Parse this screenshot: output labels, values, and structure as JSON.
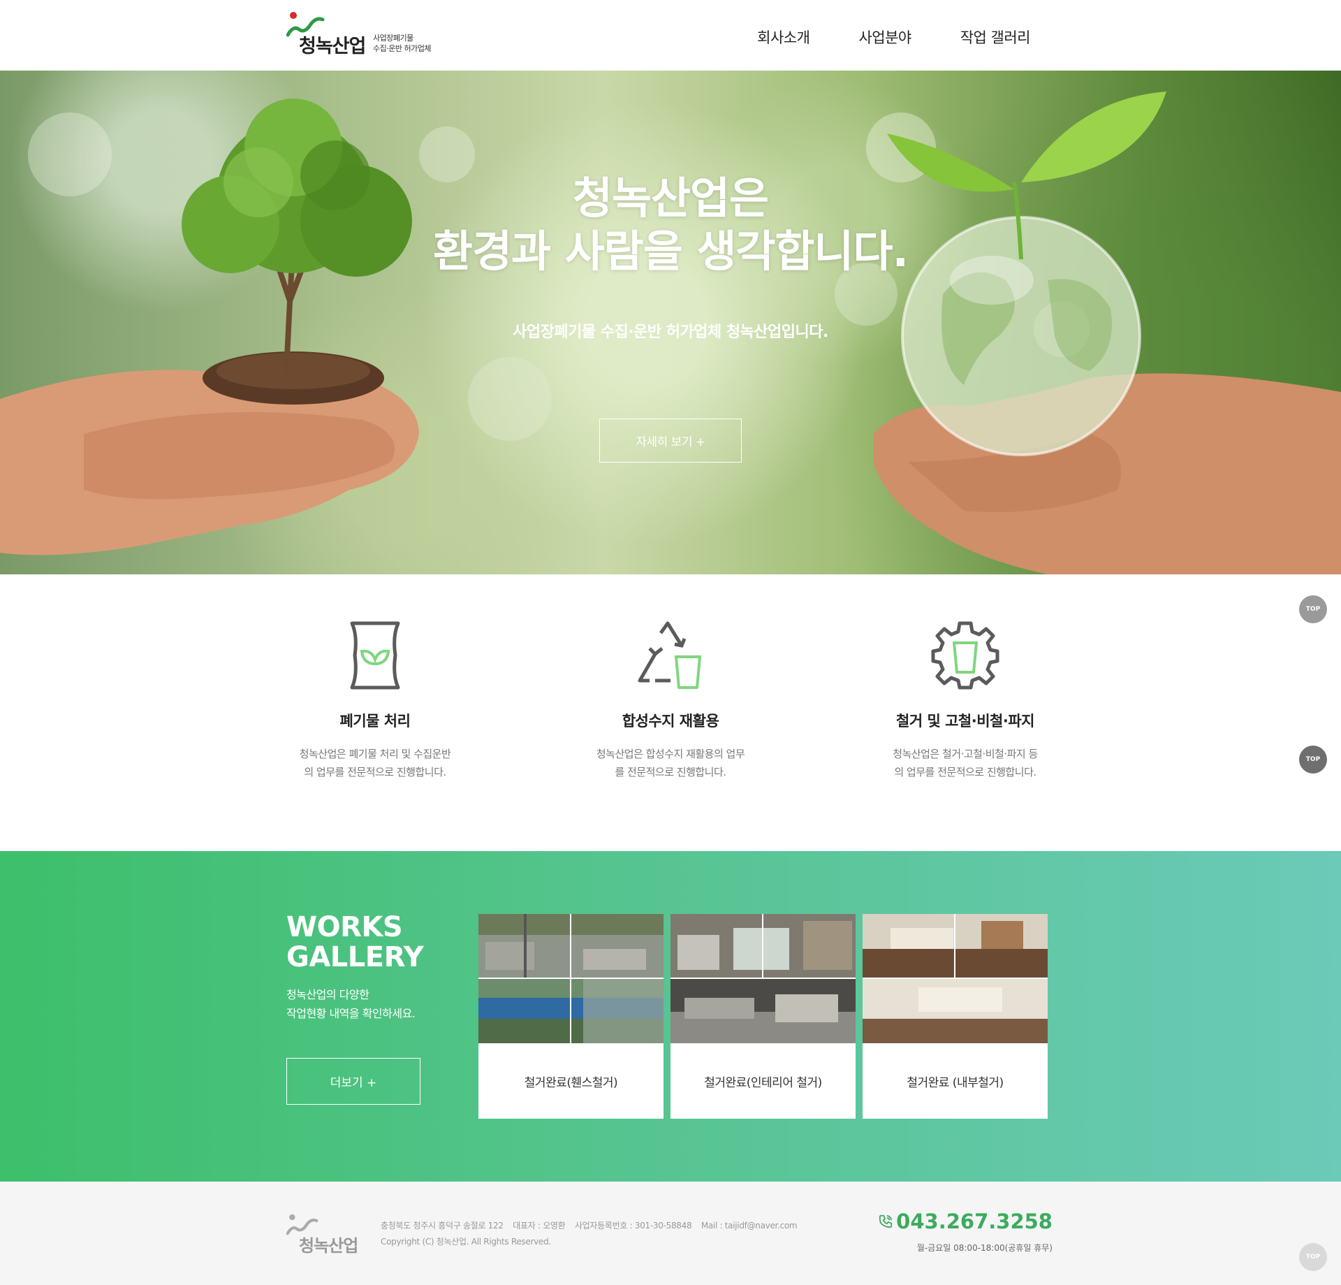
{
  "header": {
    "logo_name": "청녹산업",
    "logo_sub_line1": "사업장폐기물",
    "logo_sub_line2": "수집·운반 허가업체",
    "nav": [
      "회사소개",
      "사업분야",
      "작업 갤러리"
    ]
  },
  "hero": {
    "title_line1": "청녹산업은",
    "title_line2": "환경과 사람을 생각합니다.",
    "subtitle": "사업장폐기물 수집·운반 허가업체 청녹산업입니다.",
    "button": "자세히 보기 +"
  },
  "services": [
    {
      "icon": "waste-bag-icon",
      "title": "폐기물 처리",
      "desc_line1": "청녹산업은 폐기물 처리 및 수집운반",
      "desc_line2": "의 업무를 전문적으로 진행합니다."
    },
    {
      "icon": "recycle-icon",
      "title": "합성수지 재활용",
      "desc_line1": "청녹산업은 합성수지 재활용의 업무",
      "desc_line2": "를 전문적으로 진행합니다."
    },
    {
      "icon": "gear-icon",
      "title": "철거 및 고철·비철·파지",
      "desc_line1": "청녹산업은 철거·고철·비철·파지 등",
      "desc_line2": "의 업무를 전문적으로 진행합니다."
    }
  ],
  "gallery": {
    "title_line1": "WORKS",
    "title_line2": "GALLERY",
    "desc_line1": "청녹산업의 다양한",
    "desc_line2": "작업현황 내역을 확인하세요.",
    "button": "더보기 +",
    "cards": [
      {
        "label": "철거완료(휀스철거)"
      },
      {
        "label": "철거완료(인테리어 철거)"
      },
      {
        "label": "철거완료 (내부철거)"
      }
    ]
  },
  "footer": {
    "logo_name": "청녹산업",
    "address": "충청북도 청주시 흥덕구 송절로 122",
    "ceo": "대표자 : 오영환",
    "biz_no": "사업자등록번호 : 301-30-58848",
    "mail": "Mail : taijidf@naver.com",
    "copyright": "Copyright (C) 청녹산업. All Rights Reserved.",
    "phone": "043.267.3258",
    "hours": "월-금요일 08:00-18:00(공휴일 휴무)"
  },
  "top_button": "TOP",
  "colors": {
    "accent_green": "#3dab5f",
    "gallery_start": "#3dbf6b",
    "gallery_end": "#6bcab8",
    "logo_red": "#d42b2b"
  }
}
